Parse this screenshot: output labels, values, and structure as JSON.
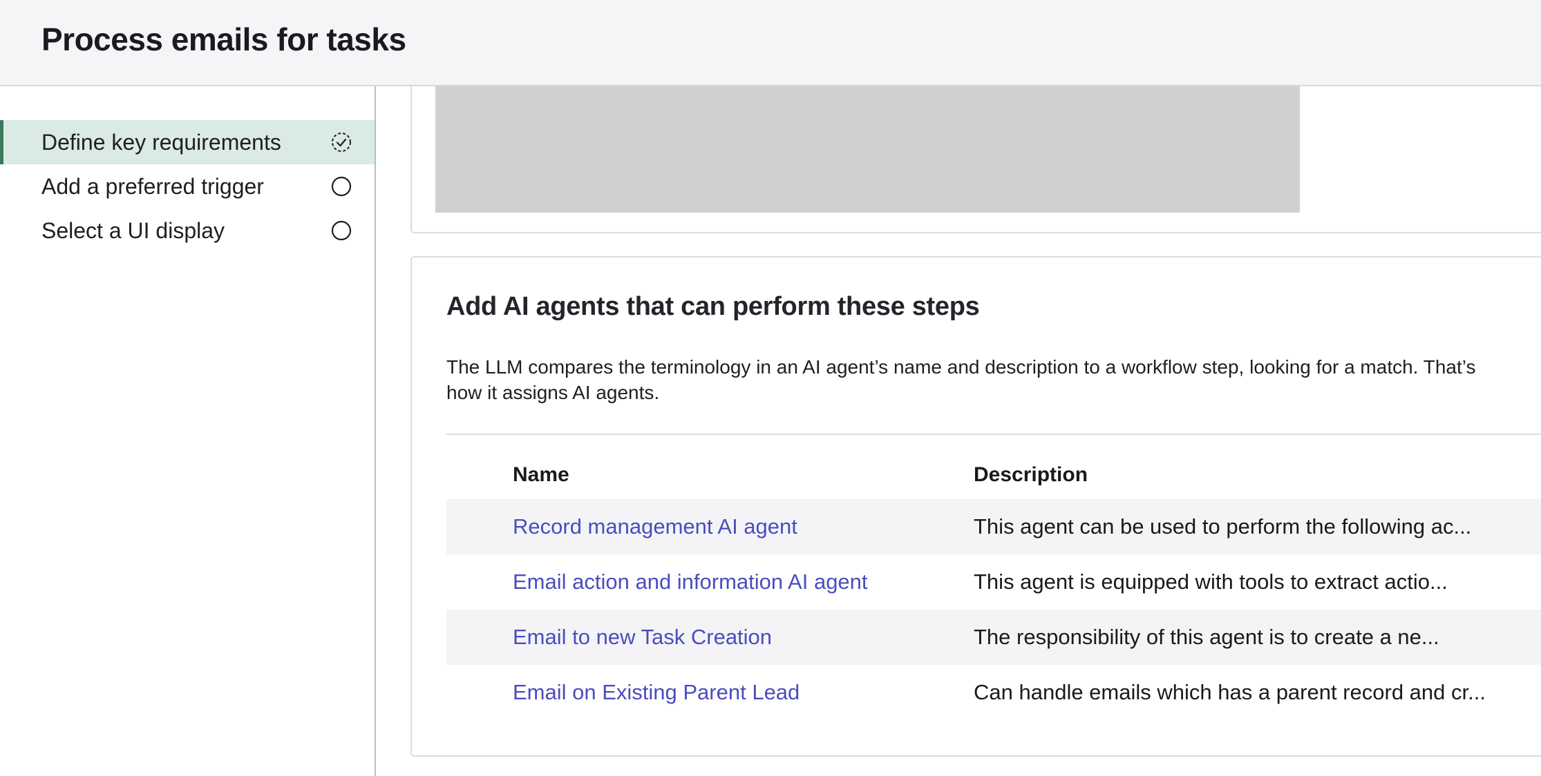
{
  "header": {
    "title": "Process emails for tasks"
  },
  "sidebar": {
    "steps": [
      {
        "label": "Define key requirements",
        "status": "in-progress",
        "active": true
      },
      {
        "label": "Add a preferred trigger",
        "status": "not-started",
        "active": false
      },
      {
        "label": "Select a UI display",
        "status": "not-started",
        "active": false
      }
    ]
  },
  "agents_section": {
    "title": "Add AI agents that can perform these steps",
    "description": "The LLM compares the terminology in an AI agent’s name and description to a workflow step, looking for a match. That’s how it assigns AI agents.",
    "columns": {
      "name": "Name",
      "description": "Description"
    },
    "rows": [
      {
        "name": "Record management AI agent",
        "description": "This agent can be used to perform the following ac..."
      },
      {
        "name": "Email action and information AI agent",
        "description": "This agent is equipped with tools to extract actio..."
      },
      {
        "name": "Email to new Task Creation",
        "description": "The responsibility of this agent is to create a ne..."
      },
      {
        "name": "Email on Existing Parent Lead",
        "description": "Can handle emails which has a parent record and cr..."
      }
    ]
  },
  "colors": {
    "active_step_bg": "#d9ebe4",
    "active_step_border": "#3b7a5a",
    "link": "#4a4dbb",
    "header_bg": "#f5f5f7"
  }
}
